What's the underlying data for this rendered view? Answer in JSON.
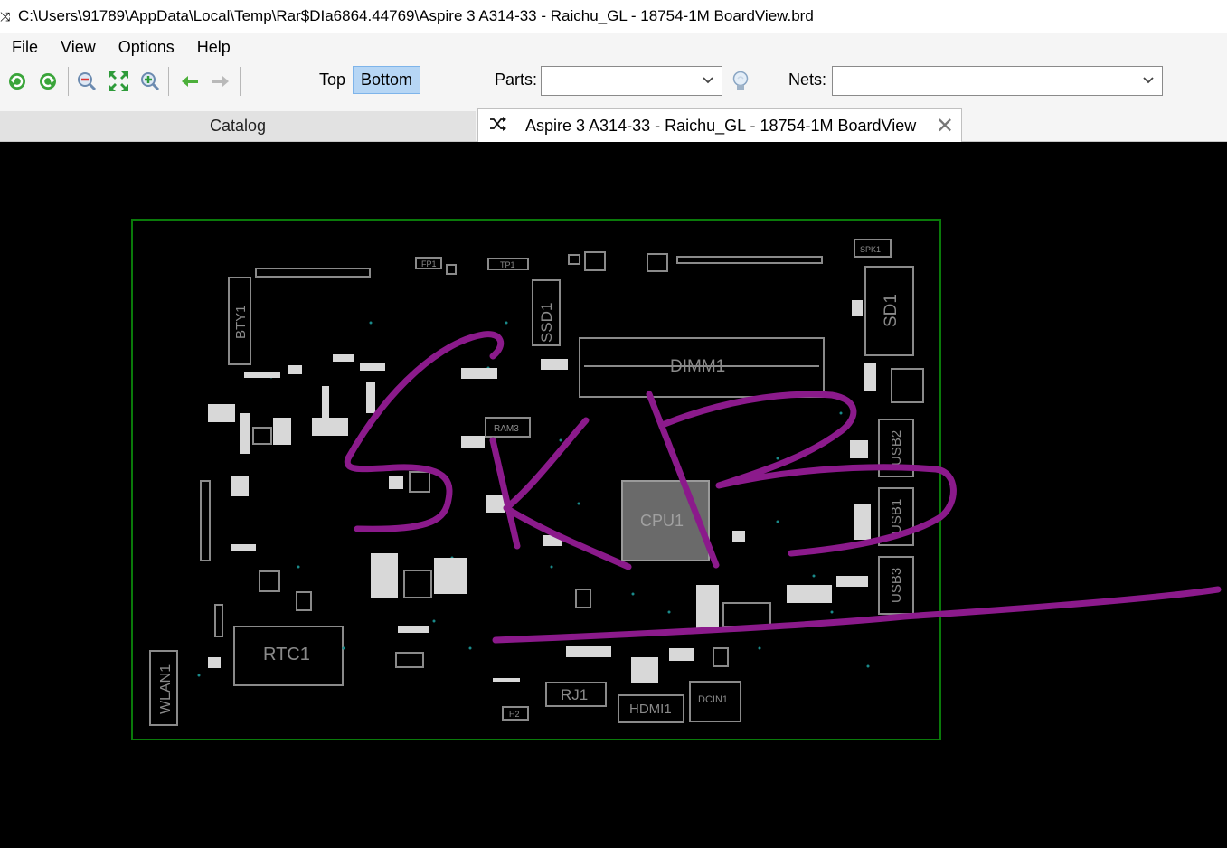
{
  "window": {
    "title": "C:\\Users\\91789\\AppData\\Local\\Temp\\Rar$DIa6864.44769\\Aspire 3 A314-33 - Raichu_GL - 18754-1M BoardView.brd",
    "app_icon": "shuffle-icon"
  },
  "menu": {
    "items": [
      "File",
      "View",
      "Options",
      "Help"
    ]
  },
  "toolbar": {
    "side_top": "Top",
    "side_bottom": "Bottom",
    "active_side": "Bottom",
    "parts_label": "Parts:",
    "parts_value": "",
    "nets_label": "Nets:",
    "nets_value": "",
    "icons": [
      "rotate-left-icon",
      "rotate-right-icon",
      "zoom-in-icon",
      "fit-icon",
      "zoom-out-icon",
      "back-arrow-icon",
      "forward-arrow-icon",
      "lightbulb-icon"
    ]
  },
  "tabs": {
    "catalog": "Catalog",
    "board": "Aspire 3 A314-33 - Raichu_GL - 18754-1M BoardView"
  },
  "board": {
    "outline_color": "#0a7a0a",
    "silk_color": "#8a8a8a",
    "annotation_color": "#8b1a8b",
    "labels": {
      "bty1": "BTY1",
      "ssd1": "SSD1",
      "dimm1": "DIMM1",
      "sd1": "SD1",
      "spk1": "SPK1",
      "usb2": "USB2",
      "usb1": "USB1",
      "usb3": "USB3",
      "cpu1": "CPU1",
      "rtc1": "RTC1",
      "wlan1": "WLAN1",
      "rj1": "RJ1",
      "hdmi1": "HDMI1",
      "dcin1": "DCIN1",
      "fp1": "FP1",
      "tp1": "TP1",
      "ram3": "RAM3",
      "h2": "H2"
    }
  }
}
